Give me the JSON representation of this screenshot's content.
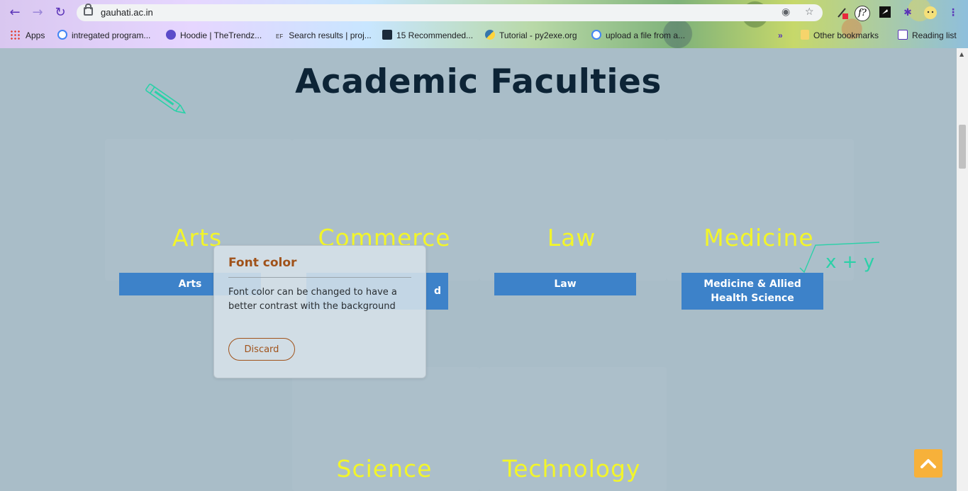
{
  "browser": {
    "url": "gauhati.ac.in",
    "bookmarks": [
      {
        "label": "Apps",
        "icon": "apps-grid-icon"
      },
      {
        "label": "intregated program...",
        "icon": "google-icon"
      },
      {
        "label": "Hoodie | TheTrendz...",
        "icon": "globe-icon"
      },
      {
        "label": "Search results | proj...",
        "icon": "ef-icon"
      },
      {
        "label": "15 Recommended...",
        "icon": "bookmark-icon"
      },
      {
        "label": "Tutorial - py2exe.org",
        "icon": "python-icon"
      },
      {
        "label": "upload a file from a...",
        "icon": "google-icon"
      }
    ],
    "other_bookmarks": "Other bookmarks",
    "reading_list": "Reading list",
    "more_label": "»"
  },
  "page": {
    "title": "Academic Faculties",
    "faculties": [
      {
        "name": "Arts",
        "button": "Arts"
      },
      {
        "name": "Commerce",
        "button": "d"
      },
      {
        "name": "Law",
        "button": "Law"
      },
      {
        "name": "Medicine",
        "button": "Medicine & Allied Health Science"
      },
      {
        "name": "Science"
      },
      {
        "name": "Technology"
      }
    ],
    "doodle_math": "x + y"
  },
  "popup": {
    "heading": "Font color",
    "text": "Font color can be changed to have a better contrast with the background",
    "discard": "Discard"
  },
  "colors": {
    "background": "#a9bdc8",
    "title": "#0d2436",
    "faculty_name": "#f2f52a",
    "button": "#3d82c9",
    "popup_accent": "#a0521a",
    "scroll_top": "#f7b13a"
  }
}
